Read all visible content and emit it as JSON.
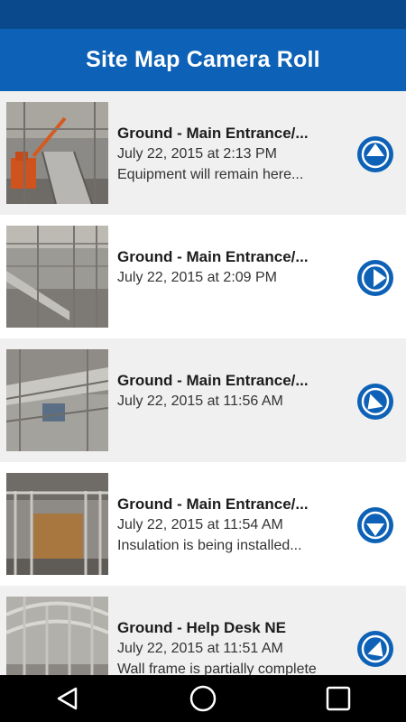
{
  "app_bar": {
    "title": "Site Map Camera Roll"
  },
  "photos": [
    {
      "title": "Ground - Main Entrance/...",
      "date": "July 22, 2015 at 2:13 PM",
      "note": "Equipment will remain here...",
      "direction_icon": "compass-north-icon",
      "direction_degrees": 0
    },
    {
      "title": "Ground - Main Entrance/...",
      "date": "July 22, 2015 at 2:09 PM",
      "note": "",
      "direction_icon": "compass-east-icon",
      "direction_degrees": 90
    },
    {
      "title": "Ground - Main Entrance/...",
      "date": "July 22, 2015 at 11:56 AM",
      "note": "",
      "direction_icon": "compass-southwest-icon",
      "direction_degrees": 225
    },
    {
      "title": "Ground - Main Entrance/...",
      "date": "July 22, 2015 at 11:54 AM",
      "note": "Insulation is being installed...",
      "direction_icon": "compass-south-icon",
      "direction_degrees": 180
    },
    {
      "title": "Ground - Help Desk NE",
      "date": "July 22, 2015 at 11:51 AM",
      "note": "Wall frame is partially complete",
      "direction_icon": "compass-southeast-icon",
      "direction_degrees": 135
    }
  ],
  "nav": {
    "back_icon": "back-triangle-icon",
    "home_icon": "home-circle-icon",
    "recents_icon": "recents-square-icon"
  },
  "colors": {
    "primary": "#0d61b6",
    "status_bar": "#0a4a8c",
    "row_alt": "#f0f0f0"
  }
}
